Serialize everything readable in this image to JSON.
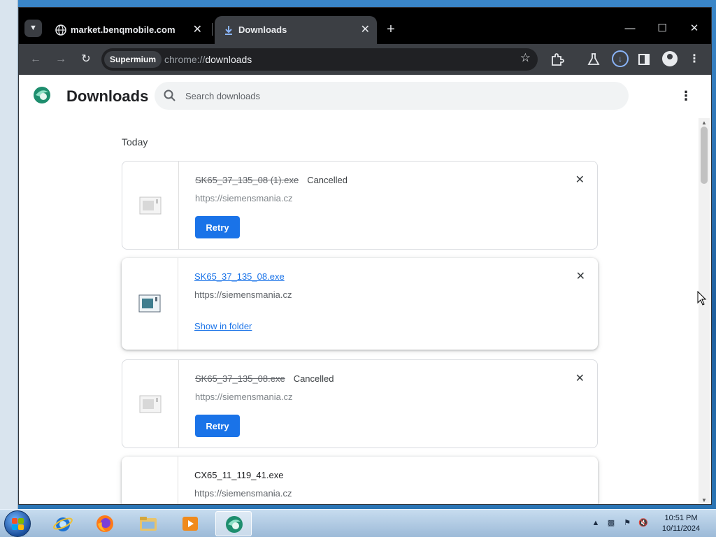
{
  "browser": {
    "tabs": [
      {
        "title": "market.benqmobile.com",
        "active": false,
        "icon": "globe-icon"
      },
      {
        "title": "Downloads",
        "active": true,
        "icon": "download-icon"
      }
    ],
    "omnibox": {
      "chip": "Supermium",
      "url_scheme": "chrome://",
      "url_path": "downloads"
    }
  },
  "page": {
    "title": "Downloads",
    "search_placeholder": "Search downloads",
    "section": "Today",
    "downloads": [
      {
        "filename": "SK65_37_135_08 (1).exe",
        "status": "Cancelled",
        "source": "https://siemensmania.cz",
        "action": "Retry",
        "state": "cancelled"
      },
      {
        "filename": "SK65_37_135_08.exe",
        "status": "",
        "source": "https://siemensmania.cz",
        "action": "Show in folder",
        "state": "complete"
      },
      {
        "filename": "SK65_37_135_08.exe",
        "status": "Cancelled",
        "source": "https://siemensmania.cz",
        "action": "Retry",
        "state": "cancelled"
      },
      {
        "filename": "CX65_11_119_41.exe",
        "status": "",
        "source": "https://siemensmania.cz",
        "action": "",
        "state": "complete"
      }
    ]
  },
  "taskbar": {
    "apps": [
      "internet-explorer-icon",
      "firefox-icon",
      "file-explorer-icon",
      "media-player-icon",
      "supermium-icon"
    ],
    "clock": {
      "time": "10:51 PM",
      "date": "10/11/2024"
    }
  },
  "colors": {
    "accent": "#1a73e8",
    "titlebar": "#000000",
    "toolbar": "#3c3f44",
    "downloadIndicator": "#8ab4f8"
  }
}
